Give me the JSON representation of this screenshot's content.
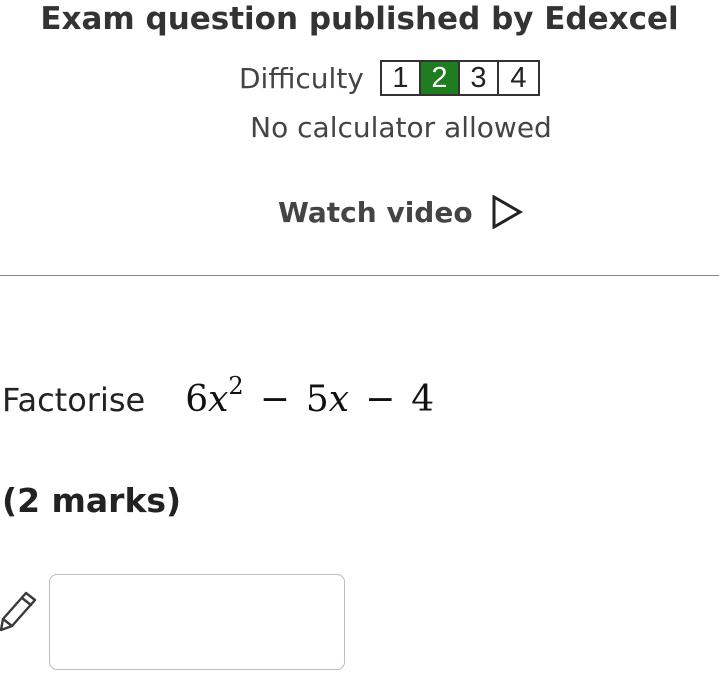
{
  "header": {
    "title": "Exam question published by Edexcel",
    "difficulty_label": "Difficulty",
    "difficulty_levels": [
      "1",
      "2",
      "3",
      "4"
    ],
    "difficulty_selected": "2",
    "calculator_note": "No calculator allowed",
    "watch_video_label": "Watch video"
  },
  "question": {
    "instruction": "Factorise",
    "expression": {
      "term1_coef": "6",
      "term1_var": "x",
      "term1_exp": "2",
      "op1": "−",
      "term2_coef": "5",
      "term2_var": "x",
      "op2": "−",
      "term3": "4"
    },
    "marks": "(2 marks)"
  },
  "answer": {
    "value": ""
  },
  "colors": {
    "difficulty_active_bg": "#1e7d1e",
    "text": "#333333",
    "answer_border": "#bdbdbd"
  },
  "icons": {
    "play": "play-triangle-icon",
    "pencil": "pencil-icon"
  }
}
